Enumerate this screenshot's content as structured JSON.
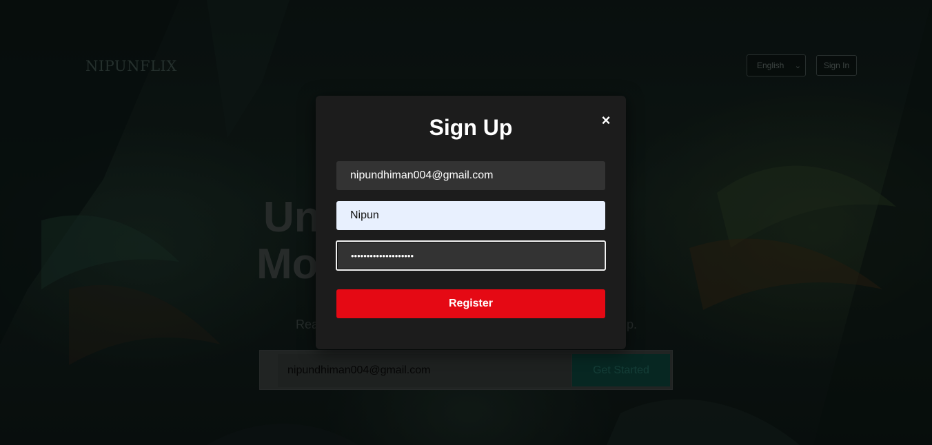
{
  "header": {
    "logo": "NIPUNFLIX",
    "language": "English",
    "signin_label": "Sign In"
  },
  "hero": {
    "title_line1": "Un",
    "title_line2": "Mo",
    "subtitle_left": "Rea",
    "subtitle_right": "p.",
    "email_value": "nipundhiman004@gmail.com",
    "cta_label": "Get Started"
  },
  "modal": {
    "title": "Sign Up",
    "close_glyph": "×",
    "email_value": "nipundhiman004@gmail.com",
    "name_value": "Nipun",
    "password_masked": "••••••••••••••••••••",
    "register_label": "Register"
  },
  "colors": {
    "accent": "#e50914",
    "modal_bg": "#1c1c1c",
    "autofill_bg": "#e8f0fe"
  }
}
